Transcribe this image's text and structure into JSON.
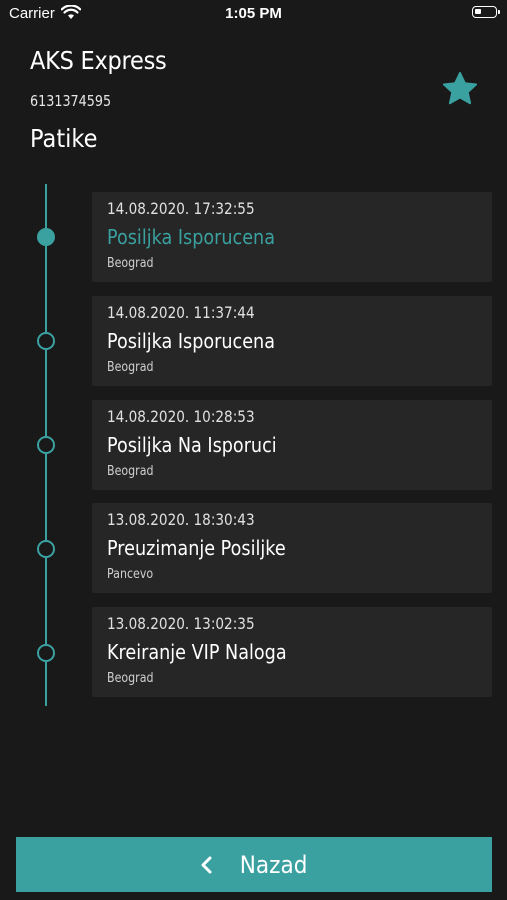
{
  "status_bar": {
    "carrier": "Carrier",
    "time": "1:05 PM"
  },
  "header": {
    "company": "AKS Express",
    "tracking_number": "6131374595",
    "package_name": "Patike",
    "favorite_icon": "star-icon"
  },
  "events": [
    {
      "date": "14.08.2020. 17:32:55",
      "status": "Posiljka Isporucena",
      "city": "Beograd",
      "active": true
    },
    {
      "date": "14.08.2020. 11:37:44",
      "status": "Posiljka Isporucena",
      "city": "Beograd",
      "active": false
    },
    {
      "date": "14.08.2020. 10:28:53",
      "status": "Posiljka Na Isporuci",
      "city": "Beograd",
      "active": false
    },
    {
      "date": "13.08.2020. 18:30:43",
      "status": "Preuzimanje Posiljke",
      "city": "Pancevo",
      "active": false
    },
    {
      "date": "13.08.2020. 13:02:35",
      "status": "Kreiranje VIP Naloga",
      "city": "Beograd",
      "active": false
    }
  ],
  "footer": {
    "back_label": "Nazad"
  },
  "colors": {
    "accent": "#3aa0a0",
    "background": "#191919",
    "card": "#262626"
  }
}
